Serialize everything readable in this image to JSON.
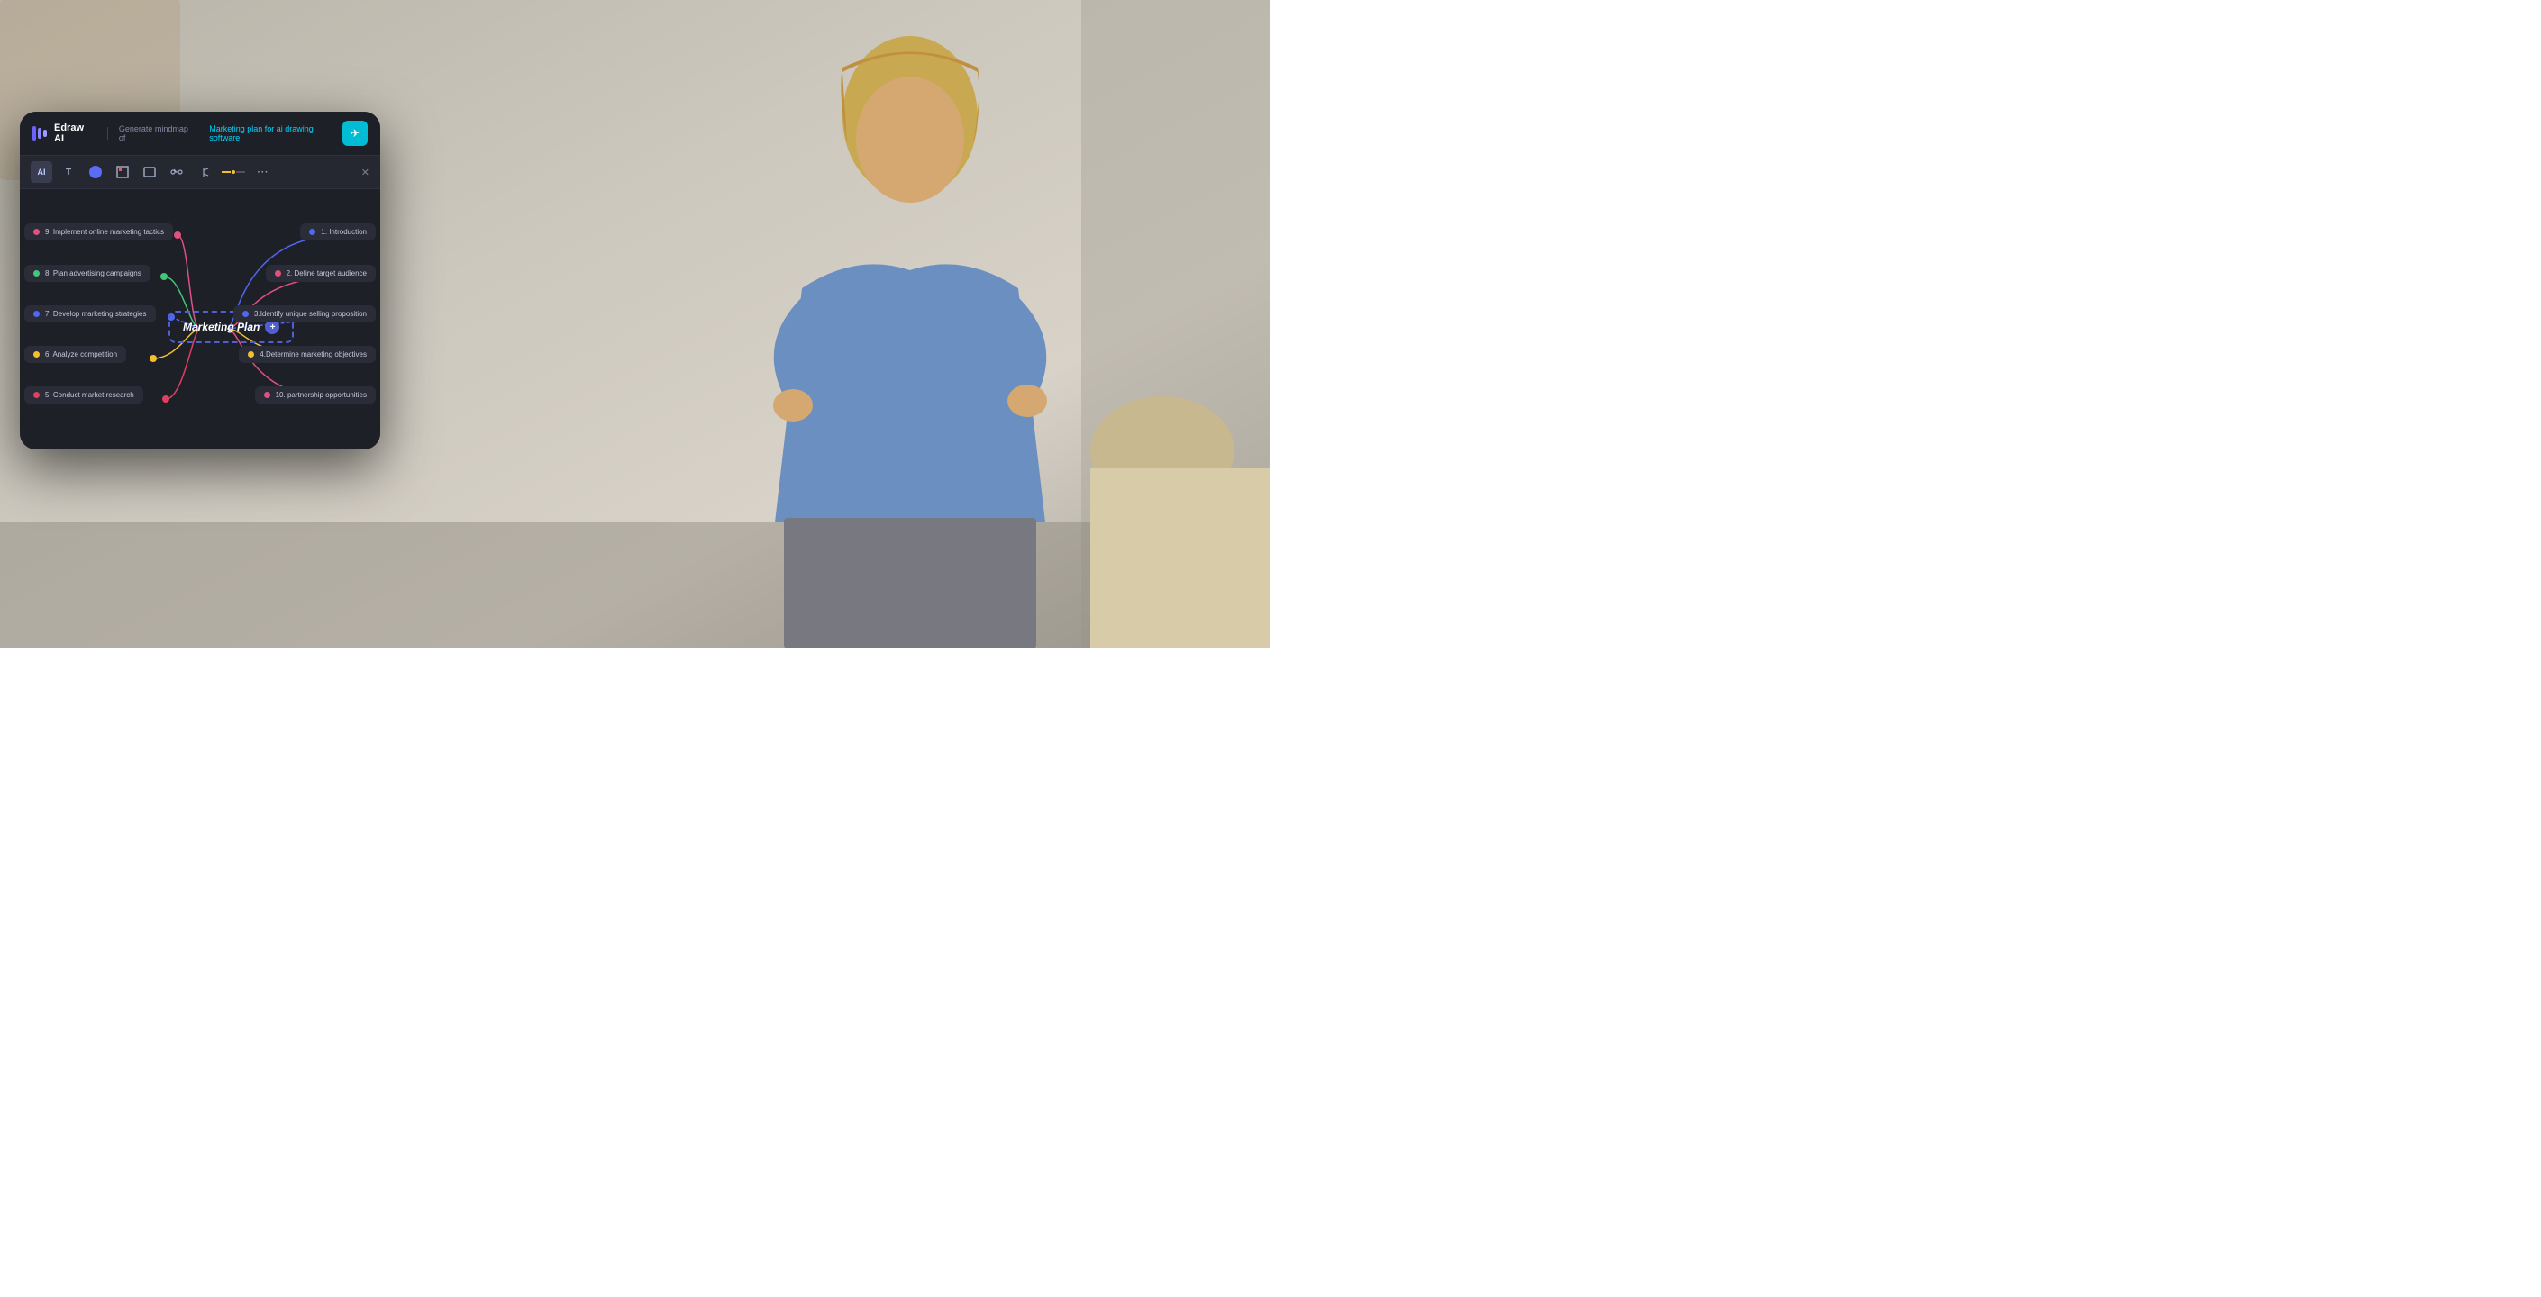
{
  "brand": {
    "name": "Edraw AI",
    "logo_bars": [
      "#6c63ff",
      "#8b83ff",
      "#a09aff"
    ]
  },
  "header": {
    "generate_prefix": "Generate mindmap of",
    "topic": "Marketing plan for ai drawing software",
    "send_label": "▶"
  },
  "toolbar": {
    "items": [
      {
        "label": "AI",
        "type": "text"
      },
      {
        "label": "T",
        "type": "text"
      },
      {
        "label": "●",
        "type": "color",
        "color": "#5B6BF5"
      },
      {
        "label": "⬔",
        "type": "icon"
      },
      {
        "label": "□",
        "type": "icon"
      },
      {
        "label": "⬡",
        "type": "icon"
      },
      {
        "label": "⟲",
        "type": "icon"
      },
      {
        "label": "—·—",
        "type": "dash"
      },
      {
        "label": "···",
        "type": "icon"
      }
    ],
    "close_label": "✕"
  },
  "center_node": {
    "label": "Marketing Plan",
    "plus": "+"
  },
  "left_nodes": [
    {
      "id": "n9",
      "label": "9. Implement online marketing tactics",
      "dot_color": "#e05080",
      "top_pct": 17
    },
    {
      "id": "n8",
      "label": "8. Plan advertising campaigns",
      "dot_color": "#40c878",
      "top_pct": 32
    },
    {
      "id": "n7",
      "label": "7. Develop marketing strategies",
      "dot_color": "#5068f0",
      "top_pct": 47
    },
    {
      "id": "n6",
      "label": "6. Analyze competition",
      "dot_color": "#f0c030",
      "top_pct": 62
    },
    {
      "id": "n5",
      "label": "5. Conduct market research",
      "dot_color": "#e04060",
      "top_pct": 77
    }
  ],
  "right_nodes": [
    {
      "id": "n1",
      "label": "1. Introduction",
      "dot_color": "#5068f0",
      "top_pct": 17
    },
    {
      "id": "n2",
      "label": "2. Define target audience",
      "dot_color": "#e05080",
      "top_pct": 32
    },
    {
      "id": "n3",
      "label": "3.Identify unique selling proposition",
      "dot_color": "#5068f0",
      "top_pct": 47
    },
    {
      "id": "n4",
      "label": "4.Determine marketing objectives",
      "dot_color": "#f0c030",
      "top_pct": 62
    },
    {
      "id": "n10",
      "label": "10. partnership opportunities",
      "dot_color": "#e05080",
      "top_pct": 77
    }
  ],
  "connection_colors": {
    "n9": "#e05080",
    "n8": "#40c878",
    "n7": "#5068f0",
    "n6": "#f0c030",
    "n5": "#e04060",
    "n1": "#5068f0",
    "n2": "#e05080",
    "n3": "#5068f0",
    "n4": "#f0c030",
    "n10": "#e05080"
  }
}
